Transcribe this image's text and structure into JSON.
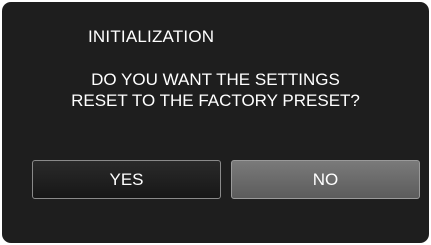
{
  "dialog": {
    "title": "INITIALIZATION",
    "message_line1": "DO YOU WANT THE SETTINGS",
    "message_line2": "RESET TO THE FACTORY PRESET?",
    "yes_label": "YES",
    "no_label": "NO"
  },
  "colors": {
    "background": "#1e1e1e",
    "text": "#ffffff",
    "yes_button": "#1f1f1f",
    "no_button": "#6b6b6b"
  }
}
